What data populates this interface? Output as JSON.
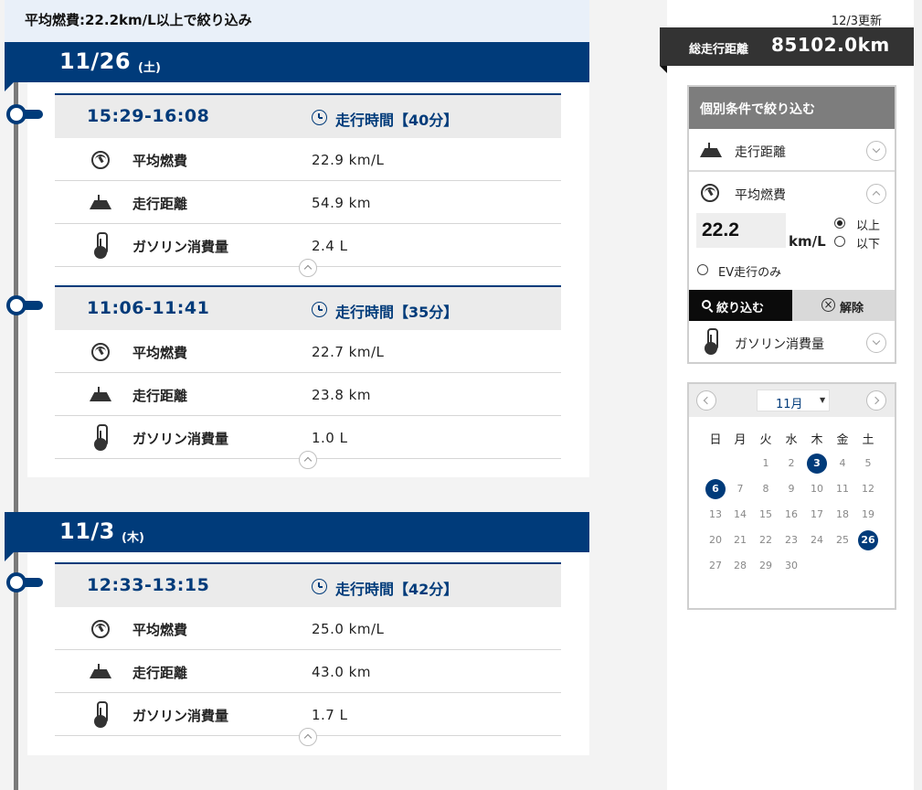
{
  "filter_banner": "平均燃費:22.2km/L以上で絞り込み",
  "updated": "12/3更新",
  "total_distance": {
    "label": "総走行距離",
    "value": "85102.0km"
  },
  "days": [
    {
      "date": "11/26",
      "dow": "(土)",
      "entries": [
        {
          "time": "15:29-16:08",
          "duration": "走行時間【40分】",
          "rows": [
            {
              "icon": "fuel-gauge-icon",
              "label": "平均燃費",
              "value": "22.9 km/L"
            },
            {
              "icon": "road-icon",
              "label": "走行距離",
              "value": "54.9 km"
            },
            {
              "icon": "thermometer-icon",
              "label": "ガソリン消費量",
              "value": "2.4 L"
            }
          ]
        },
        {
          "time": "11:06-11:41",
          "duration": "走行時間【35分】",
          "rows": [
            {
              "icon": "fuel-gauge-icon",
              "label": "平均燃費",
              "value": "22.7 km/L"
            },
            {
              "icon": "road-icon",
              "label": "走行距離",
              "value": "23.8 km"
            },
            {
              "icon": "thermometer-icon",
              "label": "ガソリン消費量",
              "value": "1.0 L"
            }
          ]
        }
      ]
    },
    {
      "date": "11/3",
      "dow": "(木)",
      "entries": [
        {
          "time": "12:33-13:15",
          "duration": "走行時間【42分】",
          "rows": [
            {
              "icon": "fuel-gauge-icon",
              "label": "平均燃費",
              "value": "25.0 km/L"
            },
            {
              "icon": "road-icon",
              "label": "走行距離",
              "value": "43.0 km"
            },
            {
              "icon": "thermometer-icon",
              "label": "ガソリン消費量",
              "value": "1.7 L"
            }
          ]
        }
      ]
    }
  ],
  "filter_panel": {
    "title": "個別条件で絞り込む",
    "distance_label": "走行距離",
    "fuel_label": "平均燃費",
    "fuel_value": "22.2",
    "fuel_unit": "km/L",
    "above_label": "以上",
    "below_label": "以下",
    "ev_only_label": "EV走行のみ",
    "search_label": "絞り込む",
    "clear_label": "解除",
    "gas_label": "ガソリン消費量",
    "selected_comparison": "以上"
  },
  "calendar": {
    "month": "11月",
    "weekdays": [
      "日",
      "月",
      "火",
      "水",
      "木",
      "金",
      "土"
    ],
    "days": [
      1,
      2,
      3,
      4,
      5,
      6,
      7,
      8,
      9,
      10,
      11,
      12,
      13,
      14,
      15,
      16,
      17,
      18,
      19,
      20,
      21,
      22,
      23,
      24,
      25,
      26,
      27,
      28,
      29,
      30
    ],
    "highlighted_days": [
      3,
      6,
      26
    ]
  },
  "colors": {
    "brand_navy": "#003b7a",
    "dark_label": "#333333",
    "filter_head": "#7d7d7d"
  }
}
